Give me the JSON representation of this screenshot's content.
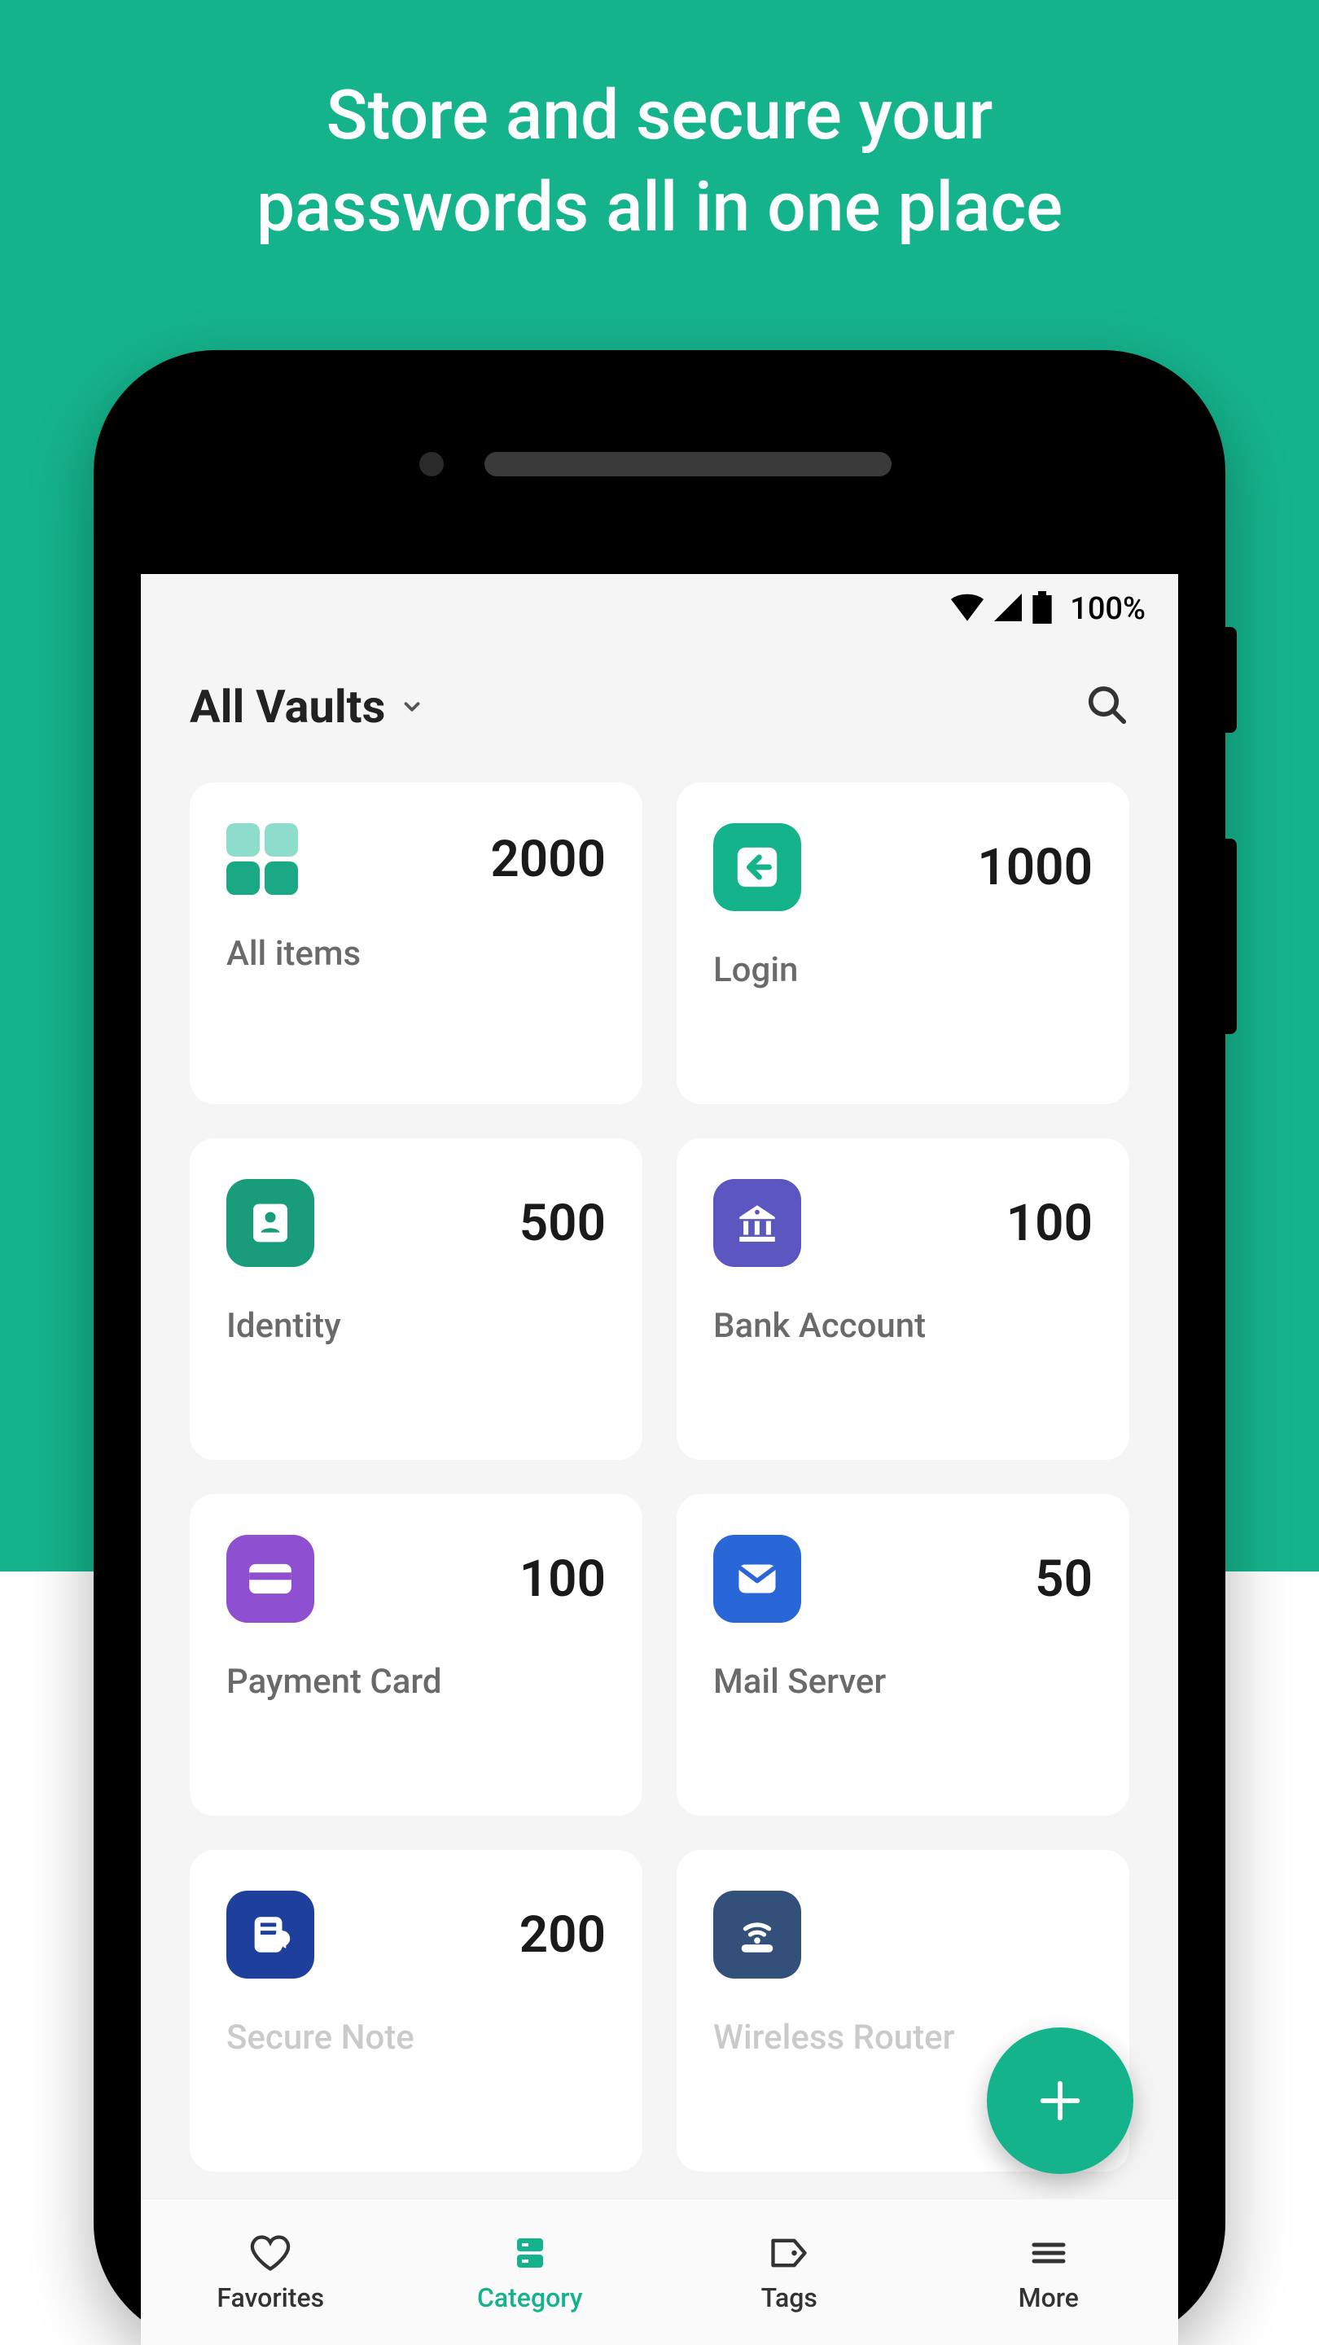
{
  "colors": {
    "teal": "#15b38c",
    "tealLight": "#8edccb",
    "purpleDark": "#5c57c0",
    "purpleLight": "#8e4fd1",
    "blue": "#2966d8",
    "navy": "#33507a",
    "blueDark": "#1e3f9b"
  },
  "heading": "Store and secure your\npasswords all in one place",
  "statusbar": {
    "battery": "100%"
  },
  "header": {
    "vault_title": "All Vaults"
  },
  "cards": [
    {
      "icon": "grid",
      "count": "2000",
      "label": "All items"
    },
    {
      "icon": "login",
      "count": "1000",
      "label": "Login"
    },
    {
      "icon": "person",
      "count": "500",
      "label": "Identity"
    },
    {
      "icon": "bank",
      "count": "100",
      "label": "Bank Account"
    },
    {
      "icon": "card",
      "count": "100",
      "label": "Payment Card"
    },
    {
      "icon": "mail",
      "count": "50",
      "label": "Mail Server"
    },
    {
      "icon": "note",
      "count": "200",
      "label": "Secure Note"
    },
    {
      "icon": "router",
      "count": "",
      "label": "Wireless Router"
    }
  ],
  "nav": [
    {
      "label": "Favorites",
      "active": false
    },
    {
      "label": "Category",
      "active": true
    },
    {
      "label": "Tags",
      "active": false
    },
    {
      "label": "More",
      "active": false
    }
  ]
}
